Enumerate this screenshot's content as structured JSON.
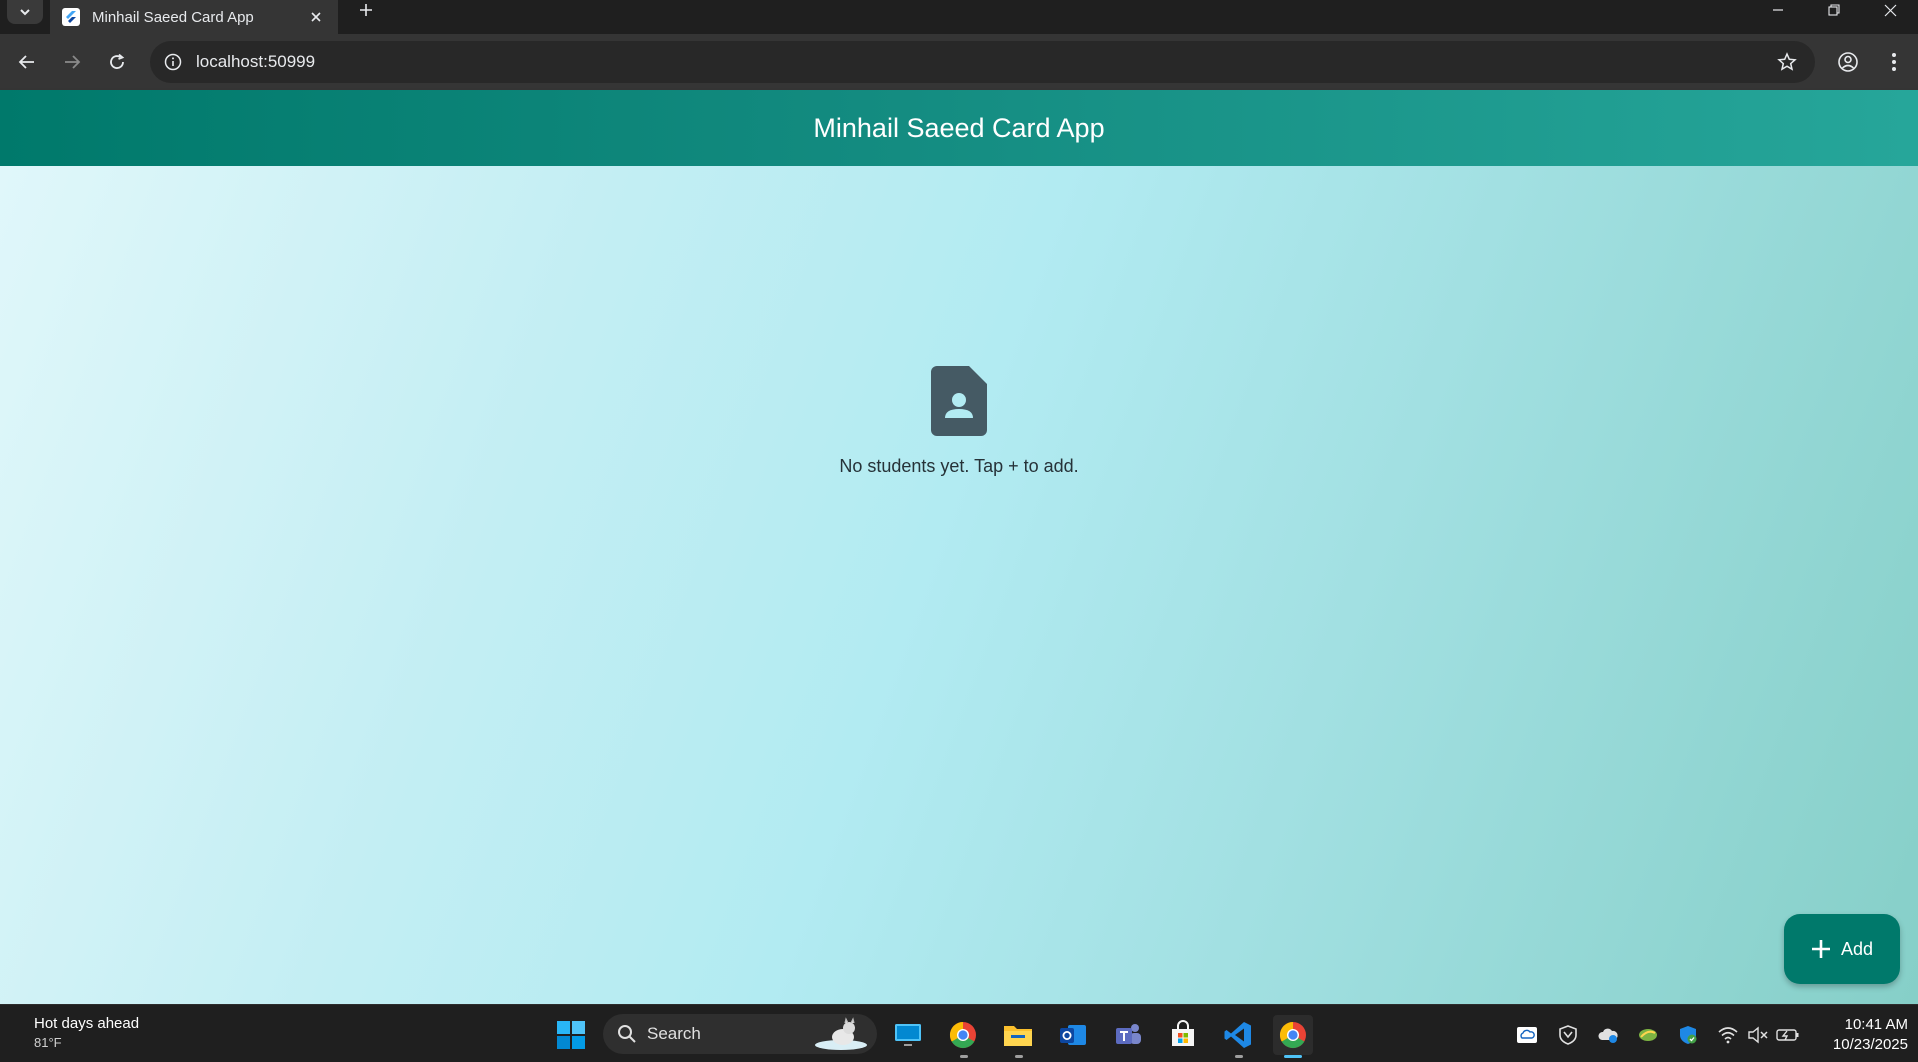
{
  "browser": {
    "tab_title": "Minhail Saeed Card App",
    "url": "localhost:50999"
  },
  "app": {
    "title": "Minhail Saeed Card App",
    "empty_message": "No students yet. Tap + to add.",
    "fab_label": "Add"
  },
  "taskbar": {
    "weather_title": "Hot days ahead",
    "weather_temp": "81°F",
    "search_label": "Search",
    "time": "10:41 AM",
    "date": "10/23/2025"
  },
  "icons": {
    "tab_search": "chevron-down-icon",
    "favicon": "flutter-icon",
    "empty_state": "contact-document-icon",
    "fab": "plus-icon"
  },
  "colors": {
    "appbar": "#00796b",
    "fab": "#00796b",
    "empty_icon": "#455a64"
  }
}
